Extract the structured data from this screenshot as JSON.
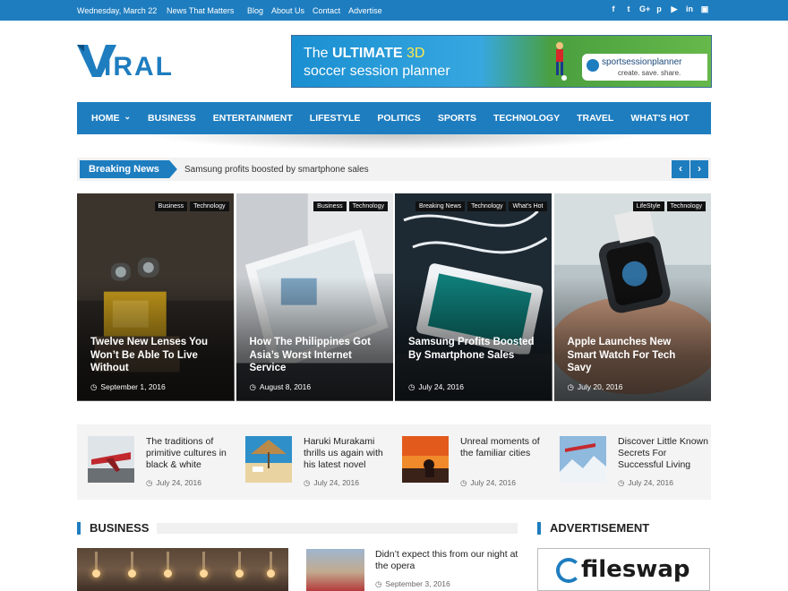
{
  "topbar": {
    "date": "Wednesday, March 22",
    "tagline": "News That Matters",
    "links": [
      "Blog",
      "About Us",
      "Contact",
      "Advertise"
    ],
    "social_icons": [
      "facebook-icon",
      "twitter-icon",
      "google-plus-icon",
      "pinterest-icon",
      "youtube-icon",
      "linkedin-icon",
      "instagram-icon"
    ]
  },
  "logo": {
    "text": "IRAL"
  },
  "ad_banner": {
    "line1_prefix": "The ",
    "line1_bold": "ULTIMATE",
    "line1_accent": " 3D",
    "line2": "soccer session planner",
    "brand": "sportsessionplanner",
    "brand_sub": "create. save. share."
  },
  "nav": {
    "items": [
      "HOME",
      "BUSINESS",
      "ENTERTAINMENT",
      "LIFESTYLE",
      "POLITICS",
      "SPORTS",
      "TECHNOLOGY",
      "TRAVEL",
      "WHAT'S HOT"
    ]
  },
  "breaking": {
    "label": "Breaking News",
    "headline": "Samsung profits boosted by smartphone sales",
    "prev": "‹",
    "next": "›"
  },
  "featured": [
    {
      "cats": [
        "Business",
        "Technology"
      ],
      "title": "Twelve New Lenses You Won’t Be Able To Live Without",
      "date": "September 1, 2016"
    },
    {
      "cats": [
        "Business",
        "Technology"
      ],
      "title": "How The Philippines Got Asia’s Worst Internet Service",
      "date": "August 8, 2016"
    },
    {
      "cats": [
        "Breaking News",
        "Technology",
        "What's Hot"
      ],
      "title": "Samsung Profits Boosted By Smartphone Sales",
      "date": "July 24, 2016"
    },
    {
      "cats": [
        "LifeStyle",
        "Technology"
      ],
      "title": "Apple Launches New Smart Watch For Tech Savy",
      "date": "July 20, 2016"
    }
  ],
  "strip": [
    {
      "title": "The traditions of primitive cultures in black & white",
      "date": "July 24, 2016"
    },
    {
      "title": "Haruki Murakami thrills us again with his latest novel",
      "date": "July 24, 2016"
    },
    {
      "title": "Unreal moments of the familiar cities",
      "date": "July 24, 2016"
    },
    {
      "title": "Discover Little Known Secrets For Successful Living",
      "date": "July 24, 2016"
    }
  ],
  "business": {
    "heading": "BUSINESS",
    "post_title": "Didn’t expect this from our night at the opera",
    "post_date": "September 3, 2016"
  },
  "advertisement": {
    "heading": "ADVERTISEMENT",
    "brand": "fileswap"
  },
  "colors": {
    "accent": "#1e7dbf",
    "background": "#ffffff",
    "strip_bg": "#f4f4f4"
  }
}
